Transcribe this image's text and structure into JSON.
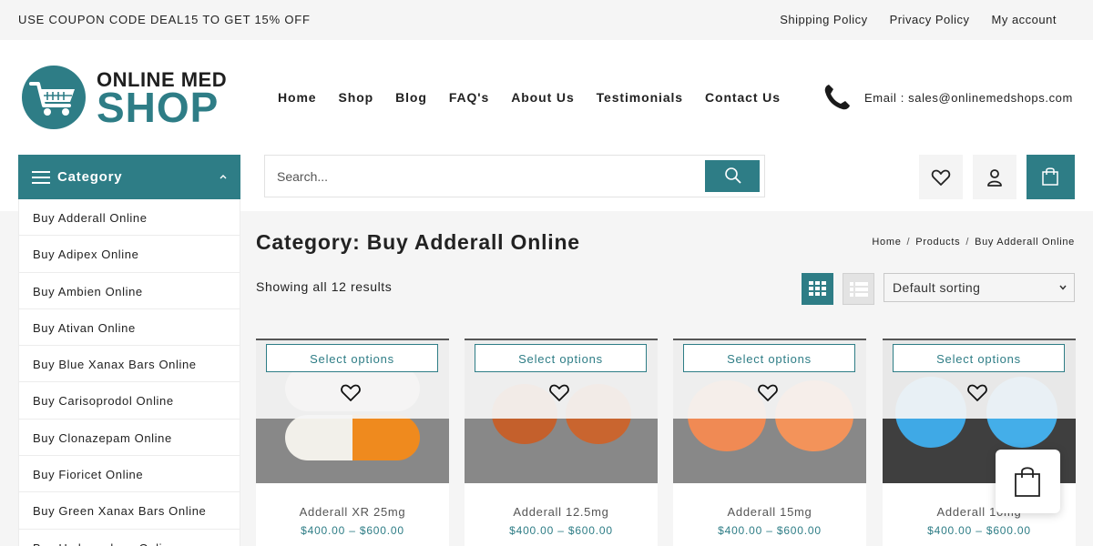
{
  "topbar": {
    "coupon": "USE COUPON CODE DEAL15 TO GET 15% OFF",
    "links": [
      "Shipping Policy",
      "Privacy Policy",
      "My account"
    ]
  },
  "logo": {
    "line1": "ONLINE MED",
    "line2": "SHOP"
  },
  "nav": [
    "Home",
    "Shop",
    "Blog",
    "FAQ's",
    "About Us",
    "Testimonials",
    "Contact Us"
  ],
  "contact": {
    "email": "Email : sales@onlinemedshops.com"
  },
  "category": {
    "label": "Category",
    "items": [
      "Buy Adderall Online",
      "Buy Adipex Online",
      "Buy Ambien Online",
      "Buy Ativan Online",
      "Buy Blue Xanax Bars Online",
      "Buy Carisoprodol Online",
      "Buy Clonazepam Online",
      "Buy Fioricet Online",
      "Buy Green Xanax Bars Online",
      "Buy Hydrocodone Online"
    ]
  },
  "search": {
    "placeholder": "Search..."
  },
  "page": {
    "title": "Category: Buy Adderall Online",
    "breadcrumb": [
      "Home",
      "Products",
      "Buy Adderall Online"
    ],
    "results": "Showing all 12 results",
    "sort": "Default sorting"
  },
  "products": [
    {
      "name": "Adderall XR 25mg",
      "price": "$400.00 – $600.00",
      "button": "Select options"
    },
    {
      "name": "Adderall 12.5mg",
      "price": "$400.00 – $600.00",
      "button": "Select options"
    },
    {
      "name": "Adderall 15mg",
      "price": "$400.00 – $600.00",
      "button": "Select options"
    },
    {
      "name": "Adderall 10mg",
      "price": "$400.00 – $600.00",
      "button": "Select options"
    }
  ],
  "colors": {
    "accent": "#2e7d86",
    "background": "#f5f5f5"
  },
  "icons": [
    "phone-icon",
    "search-icon",
    "heart-icon",
    "user-icon",
    "shopping-bag-icon",
    "grid-view-icon",
    "list-view-icon",
    "menu-icon",
    "chevron-up-icon"
  ]
}
